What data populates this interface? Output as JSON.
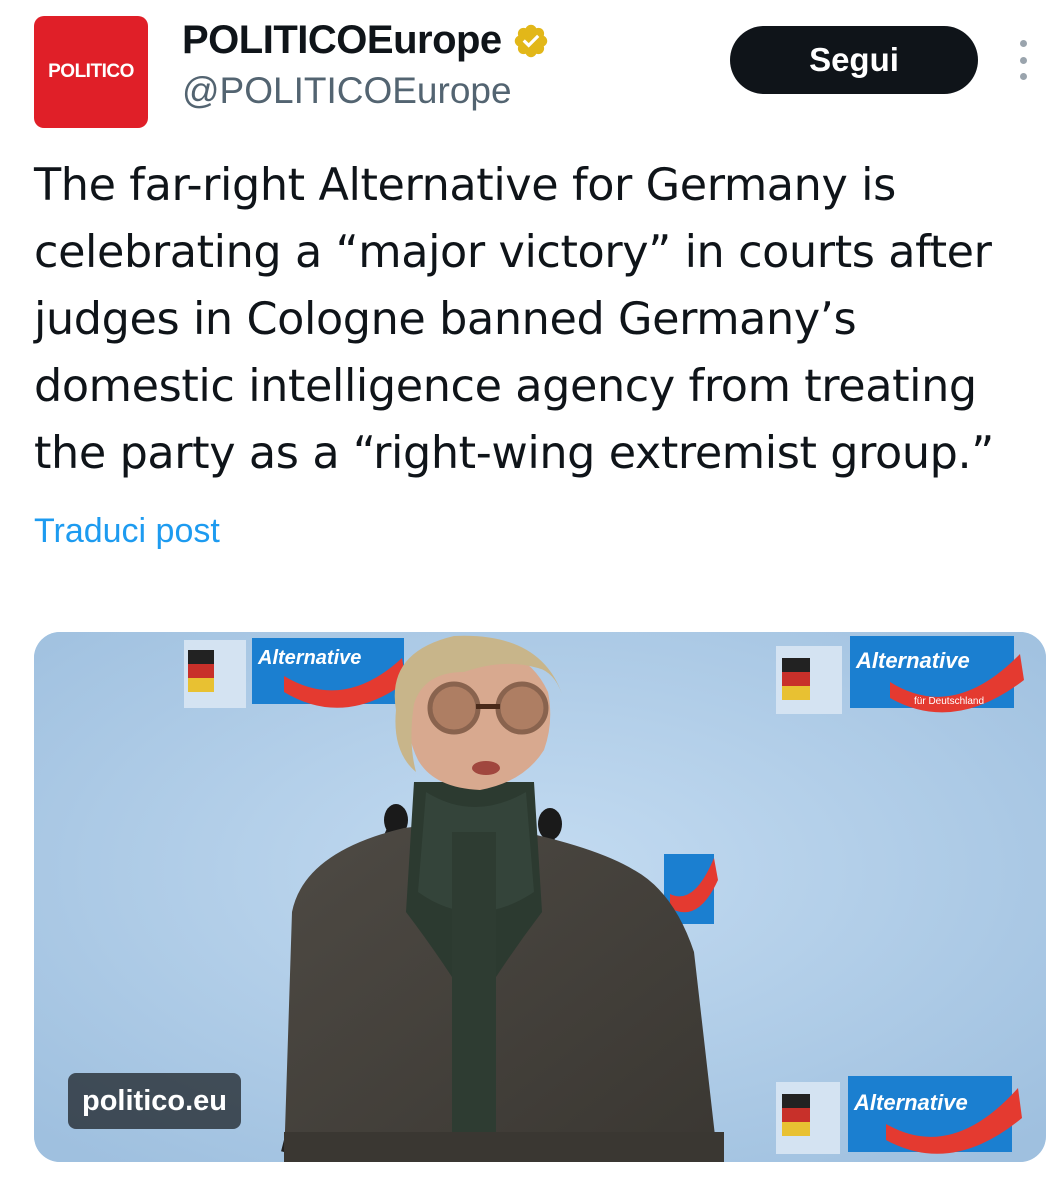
{
  "account": {
    "avatar_text": "POLITICO",
    "display_name": "POLITICOEurope",
    "handle": "@POLITICOEurope",
    "verified_icon": "verified-badge-icon",
    "verified_color": "#e2b719"
  },
  "actions": {
    "follow_label": "Segui",
    "more_icon": "more-vertical-icon"
  },
  "post": {
    "text": "The far-right Alternative for Germany is celebrating a “major victory” in courts after judges in Cologne banned Germany’s domestic intelligence agency from treating the party as a “right-wing extremist group.”",
    "translate_label": "Traduci post"
  },
  "media": {
    "source_label": "politico.eu",
    "banner_text": "Alternative",
    "banner_small": "für Deutschland"
  },
  "colors": {
    "brand_red": "#e01f28",
    "link_blue": "#1d9bf0",
    "button_dark": "#0f1419",
    "secondary_text": "#536471"
  }
}
